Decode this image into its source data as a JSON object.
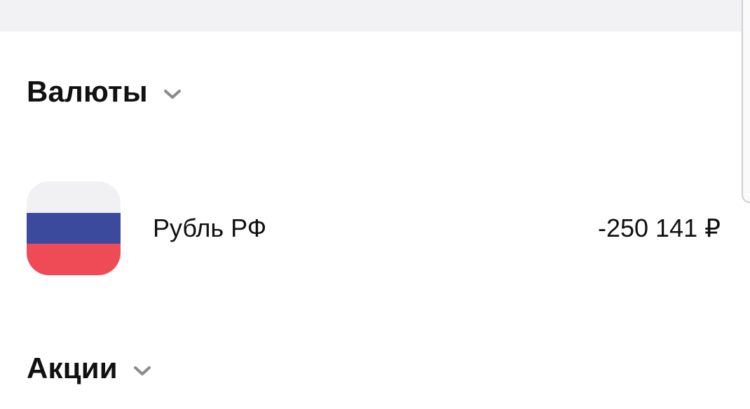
{
  "sections": {
    "currencies": {
      "title": "Валюты",
      "items": [
        {
          "name": "Рубль РФ",
          "value": "-250 141 ₽",
          "icon": "russia-flag-icon"
        }
      ]
    },
    "stocks": {
      "title": "Акции"
    }
  },
  "colors": {
    "flag_white": "#f1f1f3",
    "flag_blue": "#3c4a9e",
    "flag_red": "#ee4b57",
    "chevron": "#8a8a8f",
    "top_band": "#f2f2f4"
  }
}
